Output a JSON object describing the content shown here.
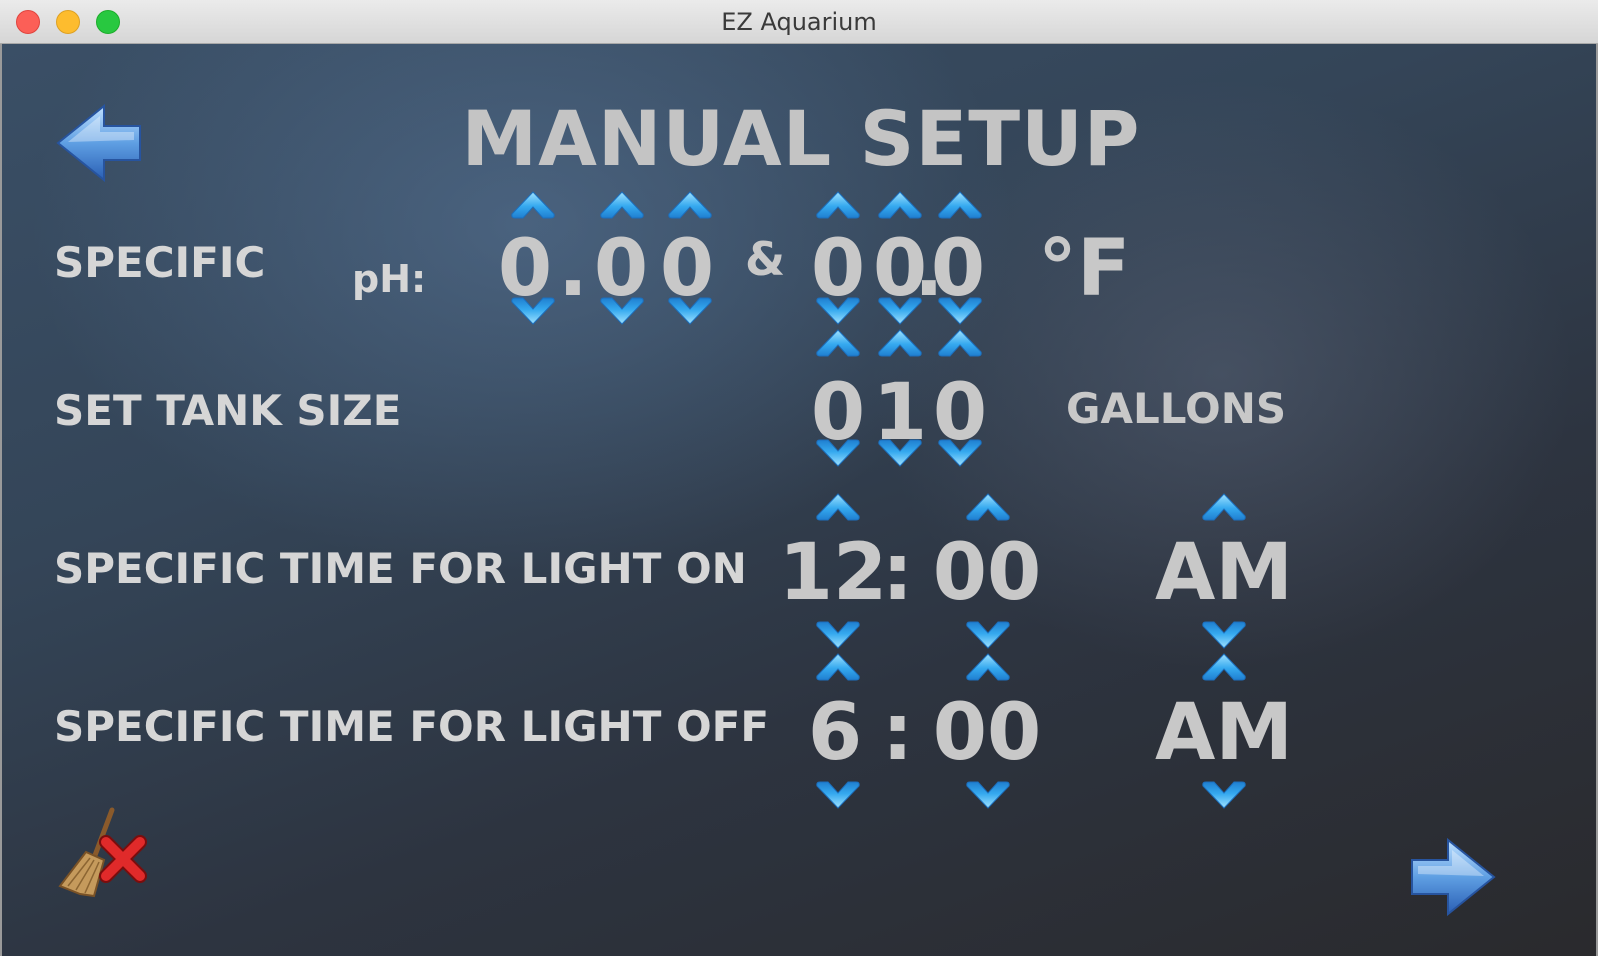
{
  "window": {
    "title": "EZ Aquarium"
  },
  "screen": {
    "title": "MANUAL SETUP"
  },
  "rows": {
    "specific": {
      "label": "SPECIFIC",
      "ph_label": "pH:",
      "ph_digit_1": "0",
      "ph_decimal": ".",
      "ph_digit_2": "0",
      "ph_digit_3": "0",
      "ampersand": "&",
      "temp_digit_1": "0",
      "temp_digit_2": "0",
      "temp_decimal": ".",
      "temp_digit_3": "0",
      "temp_unit": "°F"
    },
    "tank": {
      "label": "SET TANK SIZE",
      "digit_1": "0",
      "digit_2": "1",
      "digit_3": "0",
      "unit": "GALLONS"
    },
    "light_on": {
      "label": "SPECIFIC TIME FOR LIGHT ON",
      "hour": "12",
      "separator": ":",
      "minute": "00",
      "period": "AM"
    },
    "light_off": {
      "label": "SPECIFIC TIME FOR LIGHT OFF",
      "hour": "6",
      "separator": ":",
      "minute": "00",
      "period": "AM"
    }
  },
  "icons": {
    "back": "left-arrow-icon",
    "next": "right-arrow-icon",
    "clear": "broom-clear-icon",
    "up": "triangle-up-icon",
    "down": "triangle-down-icon"
  },
  "colors": {
    "arrow_blue": "#3aa8f0",
    "text_gray": "#c8c8c8"
  }
}
